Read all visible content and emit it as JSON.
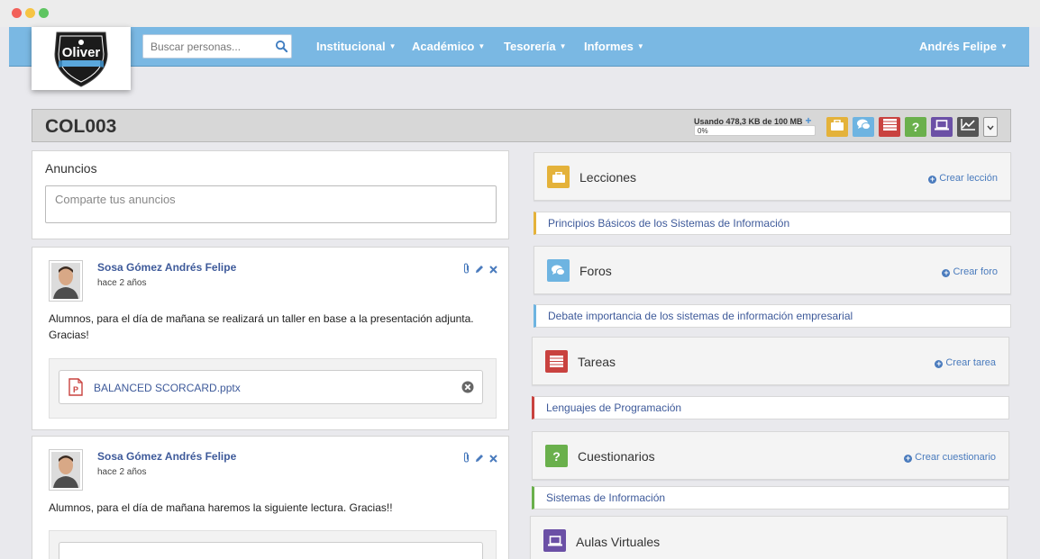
{
  "search": {
    "placeholder": "Buscar personas..."
  },
  "nav": {
    "items": [
      "Institucional",
      "Académico",
      "Tesorería",
      "Informes"
    ],
    "user": "Andrés Felipe"
  },
  "logo": {
    "text": "Oliver"
  },
  "course": {
    "title": "COL003",
    "storage_label": "Usando 478,3 KB de 100 MB",
    "storage_plus": "+",
    "progress_percent": 0,
    "progress_label": "0%",
    "toolbar_icons": [
      "briefcase-icon",
      "chat-icon",
      "tasks-icon",
      "question-icon",
      "laptop-icon",
      "chart-icon",
      "chevron-down-icon"
    ]
  },
  "colors": {
    "navbar": "#7ab8e3",
    "lecciones": "#e4b23a",
    "foros": "#6eb4e1",
    "tareas": "#c9423f",
    "cuestionarios": "#6ab04c",
    "aulas": "#6b50a6",
    "stats": "#555555"
  },
  "announcements": {
    "title": "Anuncios",
    "placeholder": "Comparte tus anuncios",
    "posts": [
      {
        "author": "Sosa Gómez Andrés Felipe",
        "time": "hace 2 años",
        "text": "Alumnos, para el día de mañana se realizará un taller en base a la presentación adjunta. Gracias!",
        "attachment": "BALANCED SCORCARD.pptx"
      },
      {
        "author": "Sosa Gómez Andrés Felipe",
        "time": "hace 2 años",
        "text": "Alumnos, para el día de mañana haremos la siguiente lectura. Gracias!!"
      }
    ]
  },
  "modules": [
    {
      "title": "Lecciones",
      "link": "Crear lección",
      "item": "Principios Básicos de los Sistemas de Información"
    },
    {
      "title": "Foros",
      "link": "Crear foro",
      "item": "Debate importancia de los sistemas de información empresarial"
    },
    {
      "title": "Tareas",
      "link": "Crear tarea",
      "item": "Lenguajes de Programación"
    },
    {
      "title": "Cuestionarios",
      "link": "Crear cuestionario",
      "item": "Sistemas de Información"
    },
    {
      "title": "Aulas Virtuales"
    }
  ]
}
